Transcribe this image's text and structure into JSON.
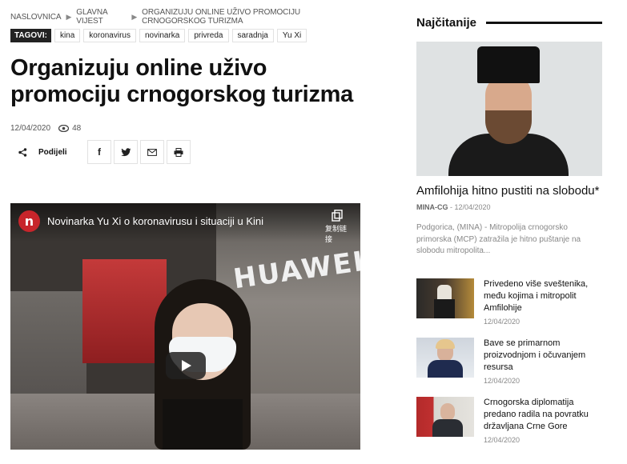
{
  "breadcrumb": [
    "NASLOVNICA",
    "GLAVNA VIJEST",
    "ORGANIZUJU ONLINE UŽIVO PROMOCIJU CRNOGORSKOG TURIZMA"
  ],
  "tags": {
    "label": "TAGOVI:",
    "items": [
      "kina",
      "koronavirus",
      "novinarka",
      "privreda",
      "saradnja",
      "Yu Xi"
    ]
  },
  "article": {
    "title": "Organizuju online uživo promociju crnogorskog turizma",
    "date": "12/04/2020",
    "views": "48"
  },
  "share": {
    "label": "Podijeli",
    "buttons": [
      "facebook-icon",
      "twitter-icon",
      "email-icon",
      "print-icon"
    ]
  },
  "video": {
    "channel_letter": "n",
    "title": "Novinarka Yu Xi o koronavirusu i situaciji u Kini",
    "copy_label": "复制链接",
    "brand_text": "HUAWEI"
  },
  "sidebar": {
    "heading": "Najčitanije",
    "featured": {
      "title": "Amfilohija hitno pustiti na slobodu*",
      "source": "MINA-CG",
      "date": "12/04/2020",
      "excerpt": "Podgorica, (MINA) - Mitropolija crnogorsko primorska (MCP) zatražila je hitno puštanje na slobodu mitropolita..."
    },
    "items": [
      {
        "title": "Privedeno više sveštenika, među kojima i mitropolit Amfilohije",
        "date": "12/04/2020"
      },
      {
        "title": "Bave se primarnom proizvodnjom i očuvanjem resursa",
        "date": "12/04/2020"
      },
      {
        "title": "Crnogorska diplomatija predano radila na povratku državljana Crne Gore",
        "date": "12/04/2020"
      }
    ]
  }
}
